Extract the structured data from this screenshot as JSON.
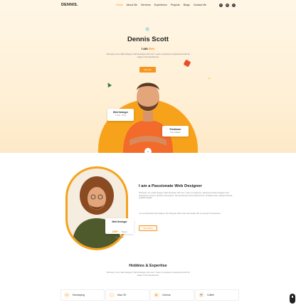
{
  "brand": {
    "logo": "DENNIS."
  },
  "nav": {
    "items": [
      "Home",
      "About Me",
      "Services",
      "Experience",
      "Projects",
      "Blogs",
      "Contact Me"
    ],
    "active": "Home"
  },
  "social": [
    "f",
    "in",
    "t"
  ],
  "hero": {
    "name": "Dennis Scott",
    "role_prefix": "I am",
    "role": "Dev",
    "intro": "Obviously I am a Web Designer. Web Developer with over 7 years of experience. Experienced with all stages of the development",
    "hire_button": "Hire Me",
    "card_web": {
      "title": "Web Desinger",
      "sub": "1 Jobs · Client"
    },
    "card_free": {
      "title": "Freelancer",
      "sub": "Hire available"
    }
  },
  "about": {
    "title": "I am a Passionate Web Designer",
    "p1": "Obviously I am a Web designer. Web Developer with over 7 years of experience. Experienced with all stages of the development cycle for dynamic web projects. The development using Content Items, templates help, making it look like readable English.",
    "p2": "I am a professional web designer. My strong job skills create web design with my all years of experience.",
    "button": "See More",
    "card": {
      "title": "Web Desinger",
      "num": "100+",
      "unit": "Project",
      "sub": "Experience"
    }
  },
  "hobbies": {
    "title": "Hobbies & Expertise",
    "subtitle": "Obviously I am a Web Designer, Web Developer with over 7 years of experience. Experienced with all stages of the development",
    "items": [
      {
        "label": "Developing",
        "icon": "code-icon"
      },
      {
        "label": "Mac OS",
        "icon": "apple-icon"
      },
      {
        "label": "Cinema",
        "icon": "film-icon"
      },
      {
        "label": "Coffee",
        "icon": "coffee-icon"
      }
    ]
  },
  "colors": {
    "accent": "#f7941d",
    "dark": "#222222"
  }
}
